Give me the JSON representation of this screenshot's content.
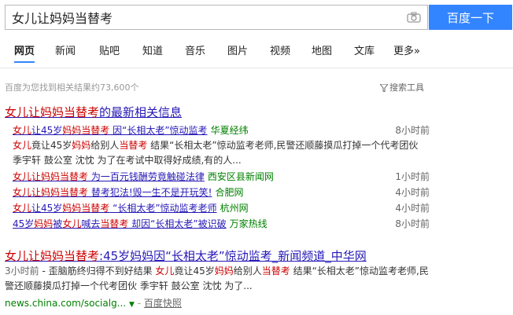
{
  "search": {
    "query": "女儿让妈妈当替考",
    "button_label": "百度一下"
  },
  "tabs": [
    "网页",
    "新闻",
    "贴吧",
    "知道",
    "音乐",
    "图片",
    "视频",
    "地图",
    "文库",
    "更多»"
  ],
  "result_count": "百度为您找到相关结果约73,600个",
  "tools_label": "搜索工具",
  "news_block": {
    "title_em": "女儿让妈妈当替考",
    "title_rest": "的最新相关信息",
    "rows": [
      {
        "parts": [
          [
            "女儿",
            1
          ],
          [
            "让45岁",
            0
          ],
          [
            "妈妈当替考",
            1
          ],
          [
            " 因“长相太老”惊动监考",
            0
          ]
        ],
        "source": "华夏经纬",
        "time": "8小时前"
      },
      {
        "parts": [
          [
            "女儿让妈妈当替考",
            1
          ],
          [
            " 为一百元钱酬劳竟触碰法律",
            0
          ]
        ],
        "source": "西安区县新闻网",
        "time": "1小时前"
      },
      {
        "parts": [
          [
            "女儿让妈妈当替考",
            1
          ],
          [
            " 替考犯法!毁一生不是开玩笑!",
            0
          ]
        ],
        "source": "合肥网",
        "time": "4小时前"
      },
      {
        "parts": [
          [
            "女儿",
            1
          ],
          [
            "让45岁",
            0
          ],
          [
            "妈妈当替考",
            1
          ],
          [
            " “长相太老”惊动监考老师",
            0
          ]
        ],
        "source": "杭州网",
        "time": "4小时前"
      },
      {
        "parts": [
          [
            "45岁",
            0
          ],
          [
            "妈妈",
            1
          ],
          [
            "被",
            0
          ],
          [
            "女儿",
            1
          ],
          [
            "喊去",
            0
          ],
          [
            "当替考",
            1
          ],
          [
            " 却因“长相太老”被识破",
            0
          ]
        ],
        "source": "万家热线",
        "time": "8小时前"
      }
    ],
    "snippet": [
      [
        "女儿",
        1
      ],
      [
        "竟让45岁",
        0
      ],
      [
        "妈妈",
        1
      ],
      [
        "给别人",
        0
      ],
      [
        "当替考",
        1
      ],
      [
        " 结果“长相太老”惊动监考老师,民警还顺藤摸瓜打掉一个代考团伙 季宇轩 鼓公室 沈忱 为了在考试中取得好成绩,有的人...",
        0
      ]
    ]
  },
  "result2": {
    "title_parts": [
      [
        "女儿让妈妈当替考",
        1
      ],
      [
        ":45岁妈妈因“长相太老”惊动监考_新闻频道_中华网",
        0
      ]
    ],
    "snippet_time": "3小时前",
    "snippet": [
      [
        " - 歪脑筋终归得不到好结果 ",
        0
      ],
      [
        "女儿",
        1
      ],
      [
        "竟让45岁",
        0
      ],
      [
        "妈妈",
        1
      ],
      [
        "给别人",
        0
      ],
      [
        "当替考",
        1
      ],
      [
        " 结果“长相太老”惊动监考老师,民警还顺藤摸瓜打掉一个代考团伙 季宇轩 鼓公室 沈忱 为了...",
        0
      ]
    ],
    "url": "news.china.com/socialg...",
    "snapshot_label": "百度快照"
  },
  "colors": {
    "accent": "#3385ff",
    "link": "#2518b5",
    "highlight": "#cc0000",
    "source": "#008000"
  }
}
